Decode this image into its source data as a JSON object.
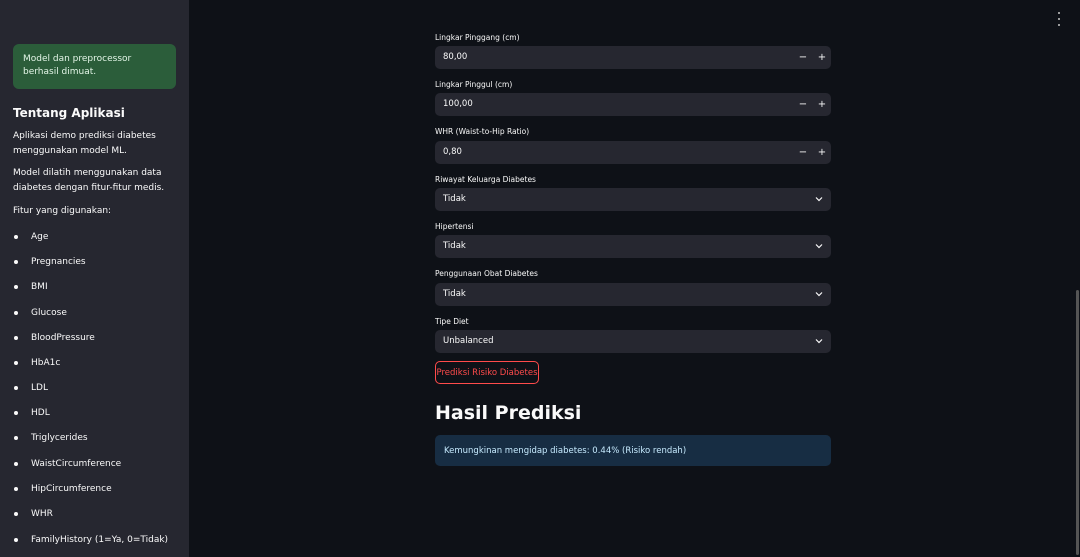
{
  "sidebar": {
    "success_message": "Model dan preprocessor berhasil dimuat.",
    "heading": "Tentang Aplikasi",
    "para1": "Aplikasi demo prediksi diabetes menggunakan model ML.",
    "para2": "Model dilatih menggunakan data diabetes dengan fitur-fitur medis.",
    "features_label": "Fitur yang digunakan:",
    "features": [
      "Age",
      "Pregnancies",
      "BMI",
      "Glucose",
      "BloodPressure",
      "HbA1c",
      "LDL",
      "HDL",
      "Triglycerides",
      "WaistCircumference",
      "HipCircumference",
      "WHR",
      "FamilyHistory (1=Ya, 0=Tidak)"
    ]
  },
  "form": {
    "waist": {
      "label": "Lingkar Pinggang (cm)",
      "value": "80,00"
    },
    "hip": {
      "label": "Lingkar Pinggul (cm)",
      "value": "100,00"
    },
    "whr": {
      "label": "WHR (Waist-to-Hip Ratio)",
      "value": "0,80"
    },
    "family_history": {
      "label": "Riwayat Keluarga Diabetes",
      "value": "Tidak"
    },
    "hypertension": {
      "label": "Hipertensi",
      "value": "Tidak"
    },
    "medication": {
      "label": "Penggunaan Obat Diabetes",
      "value": "Tidak"
    },
    "diet": {
      "label": "Tipe Diet",
      "value": "Unbalanced"
    },
    "minus_symbol": "−",
    "plus_symbol": "+",
    "predict_button": "Prediksi Risiko Diabetes"
  },
  "result": {
    "heading": "Hasil Prediksi",
    "message": "Kemungkinan mengidap diabetes: 0.44% (Risiko rendah)"
  },
  "icons": {
    "menu": "vertical-dots-icon",
    "dropdown": "chevron-down-icon"
  },
  "colors": {
    "accent": "#ff4b4b",
    "success_bg": "#2b5d3a",
    "info_bg": "#172d43"
  }
}
